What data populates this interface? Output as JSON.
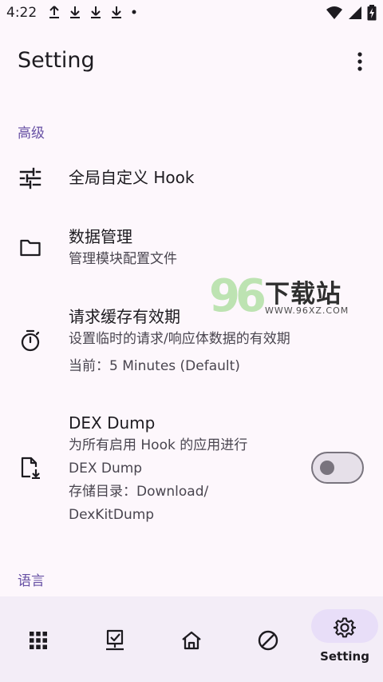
{
  "status_bar": {
    "time": "4:22",
    "left_icons": [
      "upload-icon",
      "download-icon",
      "download-icon",
      "download-icon",
      "dot-icon"
    ],
    "right_icons": [
      "wifi-icon",
      "signal-icon",
      "battery-icon"
    ]
  },
  "app_bar": {
    "title": "Setting",
    "menu_icon": "more-vert-icon"
  },
  "sections": {
    "advanced": {
      "header": "高级"
    },
    "language": {
      "header": "语言"
    }
  },
  "items": {
    "global_hook": {
      "title": "全局自定义 Hook",
      "icon": "tune-icon"
    },
    "data_manage": {
      "title": "数据管理",
      "subtitle": "管理模块配置文件",
      "icon": "folder-icon"
    },
    "cache": {
      "title": "请求缓存有效期",
      "subtitle": "设置临时的请求/响应体数据的有效期",
      "current": "当前：5 Minutes (Default)",
      "icon": "timer-icon"
    },
    "dex_dump": {
      "title": "DEX Dump",
      "subtitle_line1": "为所有启用 Hook 的应用进行",
      "subtitle_line2": "DEX Dump",
      "storage_line1": "存储目录：Download/",
      "storage_line2": "DexKitDump",
      "icon": "file-download-icon",
      "enabled": false
    }
  },
  "watermark": {
    "digits": "96",
    "title": "下载站",
    "url": "WWW.96XZ.COM"
  },
  "bottom_nav": {
    "items": [
      {
        "icon": "apps-grid-icon",
        "label": ""
      },
      {
        "icon": "desktop-check-icon",
        "label": ""
      },
      {
        "icon": "home-icon",
        "label": ""
      },
      {
        "icon": "block-icon",
        "label": ""
      },
      {
        "icon": "settings-gear-icon",
        "label": "Setting"
      }
    ],
    "selected_index": 4
  },
  "colors": {
    "background": "#fdf7fc",
    "accent": "#6750a4",
    "nav_bg": "#f3edf7",
    "nav_pill": "#e8def8"
  }
}
